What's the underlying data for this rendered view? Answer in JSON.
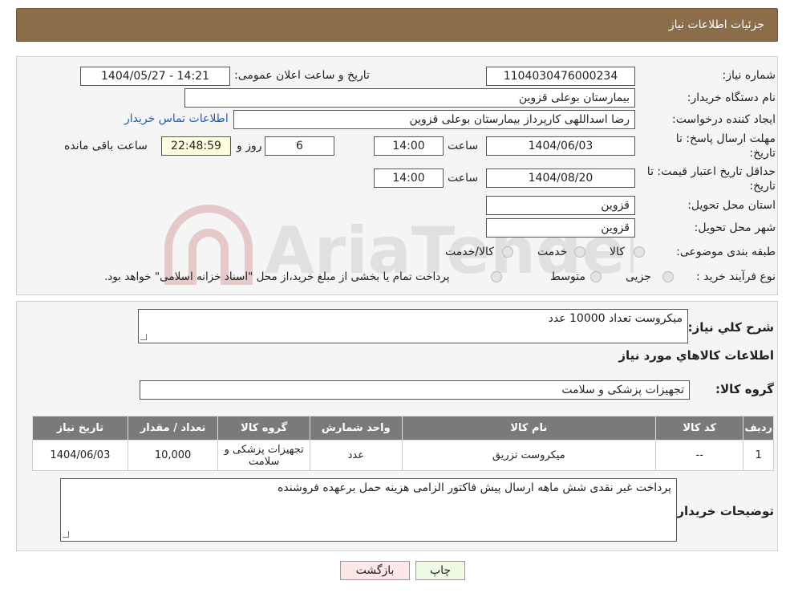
{
  "header": {
    "title": "جزئیات اطلاعات نیاز"
  },
  "form": {
    "need_number_label": "شماره نیاز:",
    "need_number": "1104030476000234",
    "announce_label": "تاریخ و ساعت اعلان عمومی:",
    "announce_value": "1404/05/27 - 14:21",
    "buyer_org_label": "نام دستگاه خریدار:",
    "buyer_org": "بیمارستان بوعلی قزوین",
    "creator_label": "ایجاد کننده درخواست:",
    "creator": "رضا اسداللهی کارپرداز بیمارستان بوعلی قزوین",
    "contact_link": "اطلاعات تماس خریدار",
    "deadline_label_1": "مهلت ارسال پاسخ: تا",
    "deadline_label_2": "تاریخ:",
    "deadline_date": "1404/06/03",
    "time_label": "ساعت",
    "deadline_time": "14:00",
    "days_value": "6",
    "days_label": "روز و",
    "remaining_time": "22:48:59",
    "remaining_label": "ساعت باقی مانده",
    "validity_label_1": "حداقل تاریخ اعتبار قیمت: تا",
    "validity_label_2": "تاریخ:",
    "validity_date": "1404/08/20",
    "validity_time": "14:00",
    "province_label": "استان محل تحویل:",
    "province": "قزوین",
    "city_label": "شهر محل تحویل:",
    "city": "قزوین",
    "category_label": "طبقه بندی موضوعی:",
    "category_options": [
      "کالا",
      "خدمت",
      "کالا/خدمت"
    ],
    "process_label": "نوع فرآیند خرید :",
    "process_options": [
      "جزیی",
      "متوسط"
    ],
    "process_note": "پرداخت تمام یا بخشی از مبلغ خرید،از محل \"اسناد خزانه اسلامی\" خواهد بود."
  },
  "summary": {
    "desc_label": "شرح کلي نياز:",
    "desc_value": "میکروست تعداد 10000 عدد",
    "goods_info_title": "اطلاعات کالاهاي مورد نياز",
    "group_label": "گروه کالا:",
    "group_value": "تجهیزات پزشکی و سلامت"
  },
  "table": {
    "headers": [
      "رديف",
      "کد کالا",
      "نام کالا",
      "واحد شمارش",
      "گروه کالا",
      "تعداد / مقدار",
      "تاریخ نیاز"
    ],
    "rows": [
      [
        "1",
        "--",
        "میکروست تزریق",
        "عدد",
        "تجهیزات پزشکی و سلامت",
        "10,000",
        "1404/06/03"
      ]
    ]
  },
  "buyer_notes": {
    "label": "توضیحات خریدار:",
    "value": "پرداخت غیر نقدی شش ماهه ارسال  پیش فاکتور الزامی هزینه حمل برعهده فروشنده"
  },
  "buttons": {
    "print": "چاپ",
    "back": "بازگشت"
  },
  "colors": {
    "header_bg": "#8b6d4a",
    "table_header_bg": "#7a7a7a",
    "link": "#1f5fb5"
  }
}
